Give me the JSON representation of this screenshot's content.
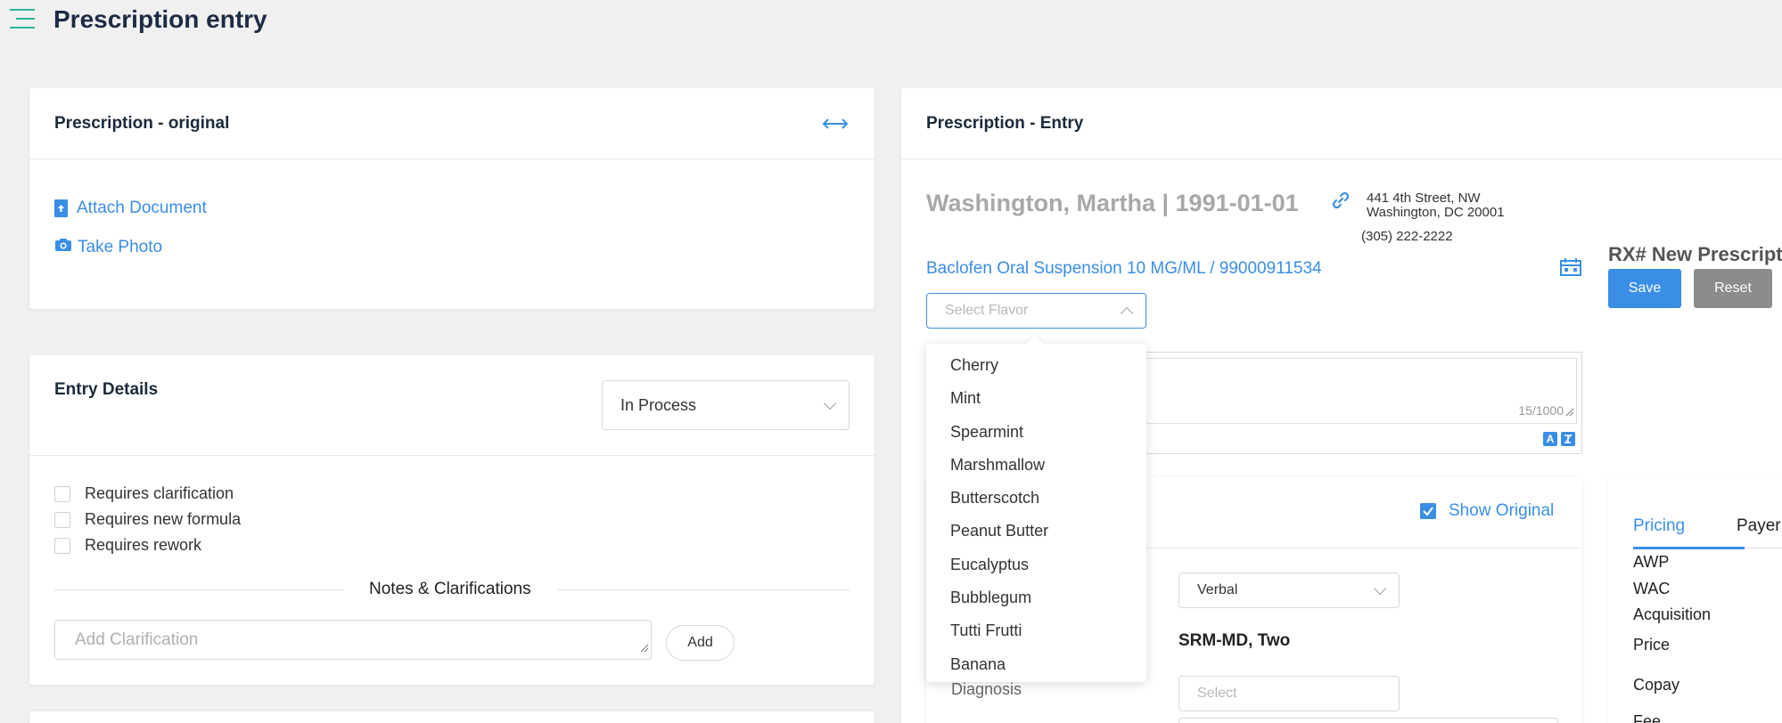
{
  "header": {
    "title": "Prescription entry"
  },
  "original_card": {
    "title": "Prescription - original",
    "attach_label": "Attach Document",
    "photo_label": "Take Photo"
  },
  "entry_details": {
    "title": "Entry Details",
    "status_value": "In Process",
    "checks": [
      "Requires clarification",
      "Requires new formula",
      "Requires rework"
    ],
    "notes_heading": "Notes & Clarifications",
    "clarification_placeholder": "Add Clarification",
    "add_label": "Add"
  },
  "entry_card": {
    "title": "Prescription - Entry",
    "patient": "Washington, Martha | 1991-01-01",
    "address_line1": "441 4th Street, NW",
    "address_line2": "Washington, DC 20001",
    "phone": "(305) 222-2222",
    "drug": "Baclofen Oral Suspension 10 MG/ML / 99000911534",
    "flavor_placeholder": "Select Flavor",
    "char_count": "15/1000",
    "show_original": "Show Original",
    "source_value": "Verbal",
    "prescriber": "SRM-MD, Two",
    "diagnosis_label": "Diagnosis",
    "diagnosis_placeholder": "Select"
  },
  "flavor_options": [
    "Cherry",
    "Mint",
    "Spearmint",
    "Marshmallow",
    "Butterscotch",
    "Peanut Butter",
    "Eucalyptus",
    "Bubblegum",
    "Tutti Frutti",
    "Banana"
  ],
  "rx_panel": {
    "title": "RX# New Prescript",
    "save_label": "Save",
    "reset_label": "Reset"
  },
  "pricing": {
    "tabs": [
      "Pricing",
      "Payer"
    ],
    "rows": [
      "AWP",
      "WAC",
      "Acquisition",
      "Price",
      "Copay",
      "Fee"
    ]
  },
  "colors": {
    "accent": "#3a8ee6",
    "header_icon": "#2bb59a",
    "reset": "#8c8c8c"
  }
}
